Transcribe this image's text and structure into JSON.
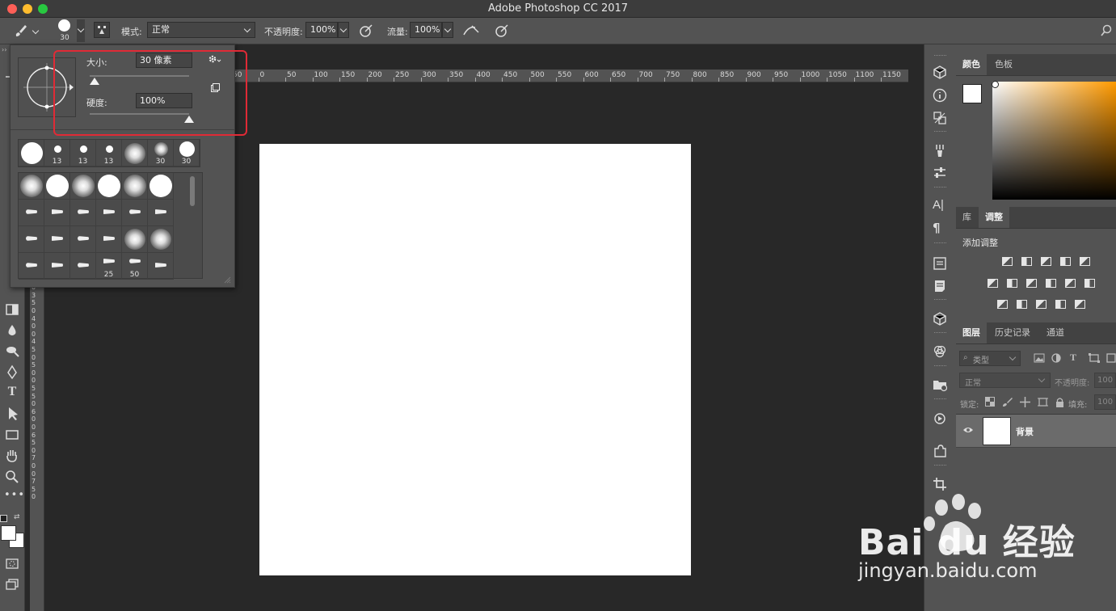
{
  "window": {
    "title": "Adobe Photoshop CC 2017"
  },
  "options_bar": {
    "brush_size_label": "30",
    "mode_label": "模式:",
    "mode_value": "正常",
    "opacity_label": "不透明度:",
    "opacity_value": "100%",
    "flow_label": "流量:",
    "flow_value": "100%"
  },
  "brush_panel": {
    "size_label": "大小:",
    "size_value": "30 像素",
    "size_fraction": 0.05,
    "hardness_label": "硬度:",
    "hardness_value": "100%",
    "hardness_fraction": 1.0,
    "recent_labels": [
      "",
      "13",
      "13",
      "13",
      "",
      "30",
      "30"
    ],
    "grid_labels": [
      "25",
      "50"
    ]
  },
  "ruler": {
    "h_labels": [
      "50",
      "0",
      "50",
      "100",
      "150",
      "200",
      "250",
      "300",
      "350",
      "400",
      "450",
      "500",
      "550",
      "600",
      "650",
      "700",
      "750",
      "800",
      "850",
      "900",
      "950",
      "1000",
      "1050",
      "1100",
      "1150"
    ],
    "v_labels": [
      "3",
      "0",
      "0",
      "3",
      "5",
      "0",
      "4",
      "0",
      "0",
      "4",
      "5",
      "0",
      "5",
      "0",
      "0",
      "5",
      "5",
      "0",
      "6",
      "0",
      "0",
      "6",
      "5",
      "0",
      "7",
      "0",
      "0",
      "7",
      "5",
      "0"
    ]
  },
  "color_panel": {
    "tabs": [
      "颜色",
      "色板"
    ],
    "active_tab": "颜色",
    "gradient_hue": "#ff9a00"
  },
  "adjust_panel": {
    "tabs": [
      "库",
      "调整"
    ],
    "active_tab": "调整",
    "add_label": "添加调整"
  },
  "layers_panel": {
    "tabs": [
      "图层",
      "历史记录",
      "通道"
    ],
    "active_tab": "图层",
    "filter_label": "类型",
    "blend_mode": "正常",
    "opacity_label": "不透明度:",
    "opacity_value": "100",
    "lock_label": "锁定:",
    "fill_label": "填充:",
    "fill_value": "100",
    "layers": [
      {
        "name": "背景",
        "visible": true
      }
    ]
  },
  "watermark": {
    "brand": "Bai du 经验",
    "url": "jingyan.baidu.com"
  },
  "colors": {
    "accent_red": "#e02a36",
    "canvas_bg": "#282828",
    "panel": "#535353"
  }
}
